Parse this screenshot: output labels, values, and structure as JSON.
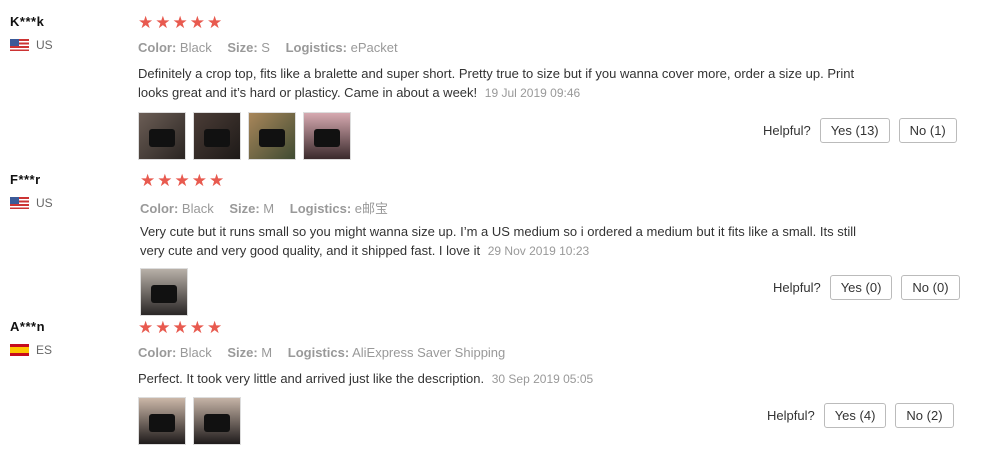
{
  "reviews": [
    {
      "username": "K***k",
      "country": "US",
      "stars": "★★★★★",
      "meta": {
        "color_label": "Color:",
        "color": "Black",
        "size_label": "Size:",
        "size": "S",
        "logistics_label": "Logistics:",
        "logistics": "ePacket"
      },
      "text": "Definitely a crop top, fits like a bralette and super short. Pretty true to size but if you wanna cover more, order a size up. Print looks great and it’s hard or plasticy. Came in about a week!",
      "date": "19 Jul 2019 09:46",
      "helpful_label": "Helpful?",
      "yes": "Yes (13)",
      "no": "No (1)"
    },
    {
      "username": "F***r",
      "country": "US",
      "stars": "★★★★★",
      "meta": {
        "color_label": "Color:",
        "color": "Black",
        "size_label": "Size:",
        "size": "M",
        "logistics_label": "Logistics:",
        "logistics": "e邮宝"
      },
      "text": "Very cute but it runs small so you might wanna size up. I’m a US medium so i ordered a medium but it fits like a small. Its still very cute and very good quality, and it shipped fast. I love it",
      "date": "29 Nov 2019 10:23",
      "helpful_label": "Helpful?",
      "yes": "Yes (0)",
      "no": "No (0)"
    },
    {
      "username": "A***n",
      "country": "ES",
      "stars": "★★★★★",
      "meta": {
        "color_label": "Color:",
        "color": "Black",
        "size_label": "Size:",
        "size": "M",
        "logistics_label": "Logistics:",
        "logistics": "AliExpress Saver Shipping"
      },
      "text": "Perfect. It took very little and arrived just like the description.",
      "date": "30 Sep 2019 05:05",
      "helpful_label": "Helpful?",
      "yes": "Yes (4)",
      "no": "No (2)"
    }
  ],
  "colors": {
    "star": "#e85a4f",
    "meta_text": "#999999",
    "body_text": "#333333"
  }
}
